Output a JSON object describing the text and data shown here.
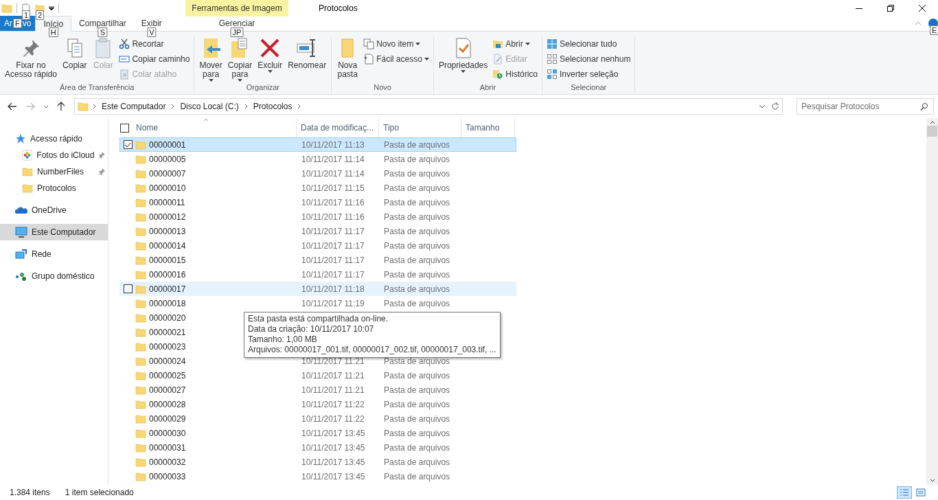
{
  "window": {
    "title": "Protocolos",
    "context_header": "Ferramentas de Imagem"
  },
  "quick_access": [
    {
      "keytip": "1"
    },
    {
      "keytip": "2"
    }
  ],
  "tabs": [
    {
      "kind": "file",
      "label_parts": [
        "Ar",
        "vo"
      ],
      "keytip": "F",
      "selected": false
    },
    {
      "kind": "normal",
      "label": "Início",
      "keytip": "H",
      "selected": true
    },
    {
      "kind": "normal",
      "label": "Compartilhar",
      "keytip": "S",
      "selected": false
    },
    {
      "kind": "normal",
      "label": "Exibir",
      "keytip": "V",
      "selected": false
    },
    {
      "kind": "context",
      "label": "Gerenciar",
      "keytip": "JP",
      "selected": false
    }
  ],
  "help_keytip": "E",
  "ribbon": {
    "groups": [
      {
        "label": "Área de Transferência",
        "large": [
          {
            "label": "Fixar no\nAcesso rápido",
            "menu": false,
            "disabled": false
          },
          {
            "label": "Copiar",
            "menu": false,
            "disabled": false
          },
          {
            "label": "Colar",
            "menu": false,
            "disabled": true
          }
        ],
        "small": [
          {
            "label": "Recortar",
            "menu": false,
            "disabled": false
          },
          {
            "label": "Copiar caminho",
            "menu": false,
            "disabled": false
          },
          {
            "label": "Colar atalho",
            "menu": false,
            "disabled": true
          }
        ]
      },
      {
        "label": "Organizar",
        "large": [
          {
            "label": "Mover\npara",
            "menu": true,
            "disabled": false
          },
          {
            "label": "Copiar\npara",
            "menu": true,
            "disabled": false
          },
          {
            "label": "Excluir",
            "menu": true,
            "disabled": false
          },
          {
            "label": "Renomear",
            "menu": false,
            "disabled": false
          }
        ]
      },
      {
        "label": "Novo",
        "large": [
          {
            "label": "Nova\npasta",
            "menu": false,
            "disabled": false
          }
        ],
        "small": [
          {
            "label": "Novo item",
            "menu": true,
            "disabled": false
          },
          {
            "label": "Fácil acesso",
            "menu": true,
            "disabled": false
          }
        ]
      },
      {
        "label": "Abrir",
        "large": [
          {
            "label": "Propriedades",
            "menu": true,
            "disabled": false
          }
        ],
        "small": [
          {
            "label": "Abrir",
            "menu": true,
            "disabled": false
          },
          {
            "label": "Editar",
            "menu": false,
            "disabled": true
          },
          {
            "label": "Histórico",
            "menu": false,
            "disabled": false
          }
        ]
      },
      {
        "label": "Selecionar",
        "small": [
          {
            "label": "Selecionar tudo",
            "menu": false,
            "disabled": false
          },
          {
            "label": "Selecionar nenhum",
            "menu": false,
            "disabled": false
          },
          {
            "label": "Inverter seleção",
            "menu": false,
            "disabled": false
          }
        ]
      }
    ]
  },
  "address": {
    "path": [
      "Este Computador",
      "Disco Local (C:)",
      "Protocolos"
    ],
    "search_placeholder": "Pesquisar Protocolos"
  },
  "nav": [
    {
      "kind": "quick",
      "label": "Acesso rápido",
      "selected": false,
      "children": [
        {
          "kind": "photos",
          "label": "Fotos do iCloud",
          "pinned": true,
          "selected": false
        },
        {
          "kind": "folder",
          "label": "NumberFiles",
          "pinned": true,
          "selected": false
        },
        {
          "kind": "folder",
          "label": "Protocolos",
          "pinned": false,
          "selected": false
        }
      ]
    },
    {
      "kind": "onedrive",
      "label": "OneDrive",
      "selected": false
    },
    {
      "kind": "pc",
      "label": "Este Computador",
      "selected": true
    },
    {
      "kind": "network",
      "label": "Rede",
      "selected": false
    },
    {
      "kind": "homegroup",
      "label": "Grupo doméstico",
      "selected": false
    }
  ],
  "select_all_checked": false,
  "columns": [
    "Nome",
    "Data de modificaç...",
    "Tipo",
    "Tamanho"
  ],
  "rows": [
    {
      "name": "00000001",
      "date": "10/11/2017 11:13",
      "type": "Pasta de arquivos",
      "selected": true,
      "hovered": false
    },
    {
      "name": "00000005",
      "date": "10/11/2017 11:14",
      "type": "Pasta de arquivos",
      "selected": false,
      "hovered": false
    },
    {
      "name": "00000007",
      "date": "10/11/2017 11:14",
      "type": "Pasta de arquivos",
      "selected": false,
      "hovered": false
    },
    {
      "name": "00000010",
      "date": "10/11/2017 11:15",
      "type": "Pasta de arquivos",
      "selected": false,
      "hovered": false
    },
    {
      "name": "00000011",
      "date": "10/11/2017 11:16",
      "type": "Pasta de arquivos",
      "selected": false,
      "hovered": false
    },
    {
      "name": "00000012",
      "date": "10/11/2017 11:16",
      "type": "Pasta de arquivos",
      "selected": false,
      "hovered": false
    },
    {
      "name": "00000013",
      "date": "10/11/2017 11:17",
      "type": "Pasta de arquivos",
      "selected": false,
      "hovered": false
    },
    {
      "name": "00000014",
      "date": "10/11/2017 11:17",
      "type": "Pasta de arquivos",
      "selected": false,
      "hovered": false
    },
    {
      "name": "00000015",
      "date": "10/11/2017 11:17",
      "type": "Pasta de arquivos",
      "selected": false,
      "hovered": false
    },
    {
      "name": "00000016",
      "date": "10/11/2017 11:17",
      "type": "Pasta de arquivos",
      "selected": false,
      "hovered": false
    },
    {
      "name": "00000017",
      "date": "10/11/2017 11:18",
      "type": "Pasta de arquivos",
      "selected": false,
      "hovered": true
    },
    {
      "name": "00000018",
      "date": "10/11/2017 11:19",
      "type": "Pasta de arquivos",
      "selected": false,
      "hovered": false
    },
    {
      "name": "00000020",
      "selected": false,
      "hovered": false
    },
    {
      "name": "00000021",
      "selected": false,
      "hovered": false
    },
    {
      "name": "00000023",
      "selected": false,
      "hovered": false
    },
    {
      "name": "00000024",
      "date": "10/11/2017 11:21",
      "type": "Pasta de arquivos",
      "selected": false,
      "hovered": false
    },
    {
      "name": "00000025",
      "date": "10/11/2017 11:21",
      "type": "Pasta de arquivos",
      "selected": false,
      "hovered": false
    },
    {
      "name": "00000027",
      "date": "10/11/2017 11:21",
      "type": "Pasta de arquivos",
      "selected": false,
      "hovered": false
    },
    {
      "name": "00000028",
      "date": "10/11/2017 11:22",
      "type": "Pasta de arquivos",
      "selected": false,
      "hovered": false
    },
    {
      "name": "00000029",
      "date": "10/11/2017 11:22",
      "type": "Pasta de arquivos",
      "selected": false,
      "hovered": false
    },
    {
      "name": "00000030",
      "date": "10/11/2017 13:45",
      "type": "Pasta de arquivos",
      "selected": false,
      "hovered": false
    },
    {
      "name": "00000031",
      "date": "10/11/2017 13:45",
      "type": "Pasta de arquivos",
      "selected": false,
      "hovered": false
    },
    {
      "name": "00000032",
      "date": "10/11/2017 13:45",
      "type": "Pasta de arquivos",
      "selected": false,
      "hovered": false
    },
    {
      "name": "00000033",
      "date": "10/11/2017 13:45",
      "type": "Pasta de arquivos",
      "selected": false,
      "hovered": false
    }
  ],
  "tooltip": [
    "Esta pasta está compartilhada on-line.",
    "Data da criação: 10/11/2017 10:07",
    "Tamanho: 1,00 MB",
    "Arquivos: 00000017_001.tif, 00000017_002.tif, 00000017_003.tif, ..."
  ],
  "status_bar": {
    "count": "1.384 itens",
    "selection": "1 item selecionado"
  },
  "views": [
    {
      "kind": "details",
      "selected": true
    },
    {
      "kind": "large_icons",
      "selected": false
    }
  ]
}
